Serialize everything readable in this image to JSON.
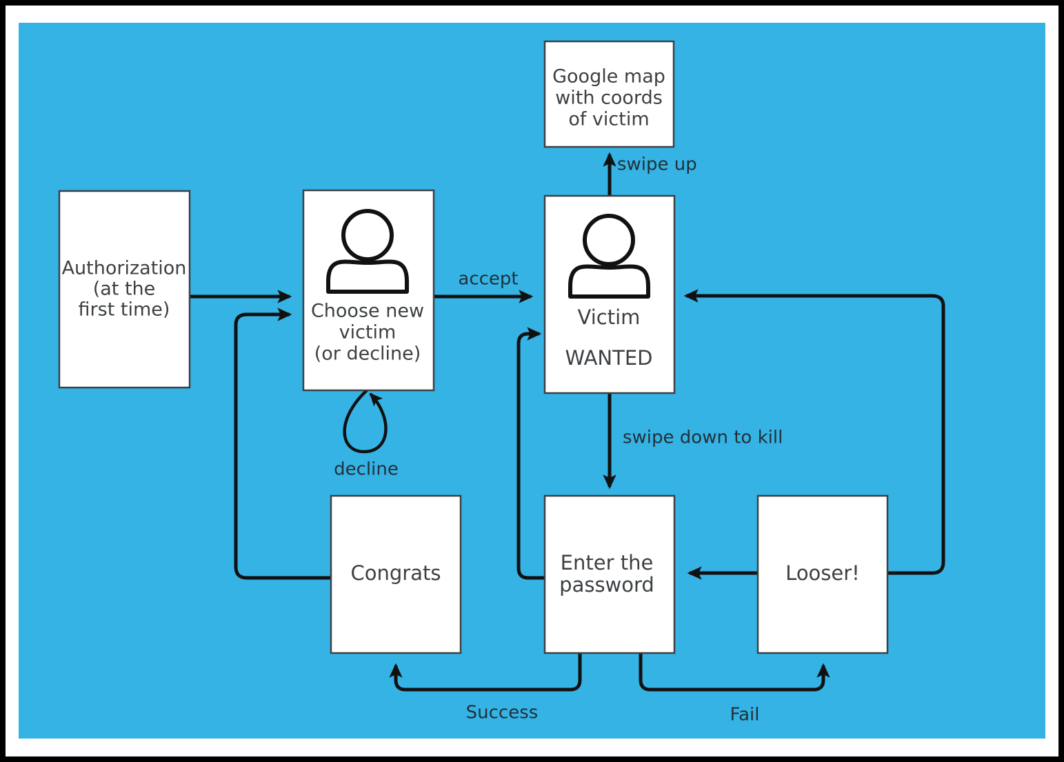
{
  "diagram": {
    "title": "App flow diagram",
    "background_color": "#35b3e4",
    "frame_color": "#000000",
    "mat_color": "#ffffff",
    "node_fill": "#ffffff",
    "node_stroke": "#3c4043",
    "edge_color": "#111111",
    "type": "flowchart",
    "nodes": [
      {
        "id": "authorization",
        "label_lines": [
          "Authorization",
          "(at the",
          "first time)"
        ],
        "icon": "none"
      },
      {
        "id": "choose-new-victim",
        "label_lines": [
          "Choose new",
          "victim",
          "(or decline)"
        ],
        "icon": "person-icon"
      },
      {
        "id": "victim",
        "label_lines": [
          "Victim",
          "WANTED"
        ],
        "icon": "person-icon"
      },
      {
        "id": "google-map",
        "label_lines": [
          "Google map",
          "with coords",
          "of victim"
        ],
        "icon": "none"
      },
      {
        "id": "congrats",
        "label_lines": [
          "Congrats"
        ],
        "icon": "none"
      },
      {
        "id": "enter-the-password",
        "label_lines": [
          "Enter the",
          "password"
        ],
        "icon": "none"
      },
      {
        "id": "looser",
        "label_lines": [
          "Looser!"
        ],
        "icon": "none"
      }
    ],
    "edges": [
      {
        "id": "auth-to-choose",
        "from": "authorization",
        "to": "choose-new-victim",
        "label": ""
      },
      {
        "id": "choose-to-victim",
        "from": "choose-new-victim",
        "to": "victim",
        "label": "accept"
      },
      {
        "id": "choose-self-loop",
        "from": "choose-new-victim",
        "to": "choose-new-victim",
        "label": "decline"
      },
      {
        "id": "victim-to-map",
        "from": "victim",
        "to": "google-map",
        "label": "swipe up"
      },
      {
        "id": "victim-to-password",
        "from": "victim",
        "to": "enter-the-password",
        "label": "swipe down to kill"
      },
      {
        "id": "password-to-congrats",
        "from": "enter-the-password",
        "to": "congrats",
        "label": "Success"
      },
      {
        "id": "password-to-looser",
        "from": "enter-the-password",
        "to": "looser",
        "label": "Fail"
      },
      {
        "id": "congrats-to-choose",
        "from": "congrats",
        "to": "choose-new-victim",
        "label": ""
      },
      {
        "id": "password-to-victim",
        "from": "enter-the-password",
        "to": "victim",
        "label": ""
      },
      {
        "id": "looser-to-password",
        "from": "looser",
        "to": "enter-the-password",
        "label": ""
      },
      {
        "id": "looser-to-victim",
        "from": "looser",
        "to": "victim",
        "label": ""
      }
    ],
    "labels": {
      "authorization_l1": "Authorization",
      "authorization_l2": "(at the",
      "authorization_l3": "first time)",
      "choose_l1": "Choose new",
      "choose_l2": "victim",
      "choose_l3": "(or decline)",
      "victim_l1": "Victim",
      "victim_l2": "WANTED",
      "map_l1": "Google map",
      "map_l2": "with coords",
      "map_l3": "of victim",
      "congrats_l1": "Congrats",
      "password_l1": "Enter the",
      "password_l2": "password",
      "looser_l1": "Looser!",
      "edge_accept": "accept",
      "edge_decline": "decline",
      "edge_swipe_up": "swipe up",
      "edge_swipe_down": "swipe down to kill",
      "edge_success": "Success",
      "edge_fail": "Fail"
    }
  }
}
